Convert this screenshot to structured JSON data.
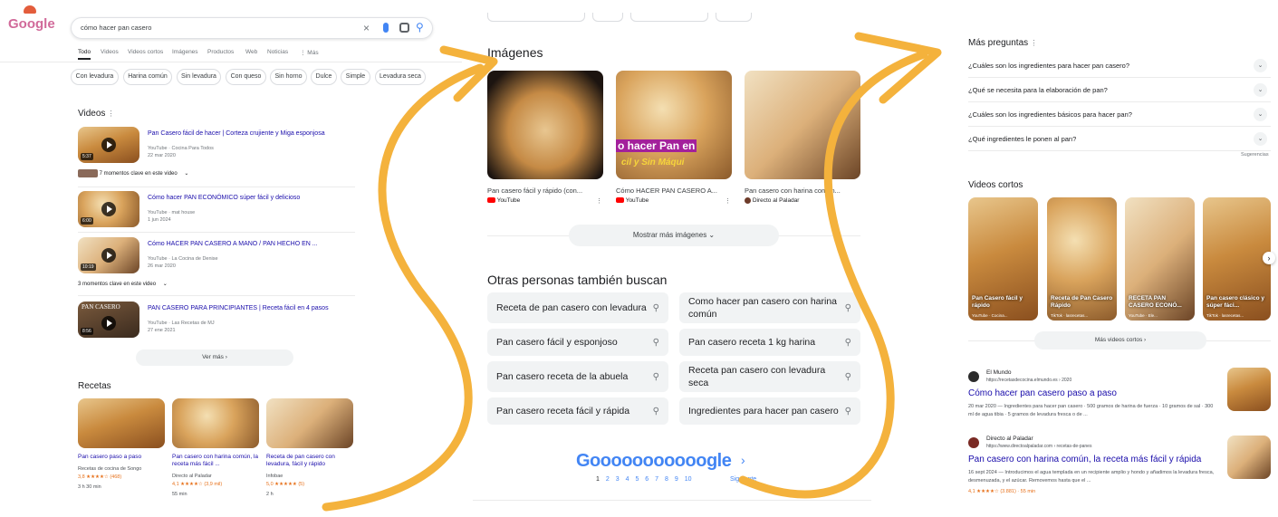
{
  "search": {
    "logo": "Google",
    "query": "cómo hacer pan casero",
    "tabs": [
      "Todo",
      "Videos",
      "Videos cortos",
      "Imágenes",
      "Productos",
      "Web",
      "Noticias",
      "⋮ Más"
    ],
    "chips": [
      "Con levadura",
      "Harina común",
      "Sin levadura",
      "Con queso",
      "Sin horno",
      "Dulce",
      "Simple",
      "Levadura seca"
    ]
  },
  "videos": {
    "heading": "Videos",
    "items": [
      {
        "title": "Pan Casero fácil de hacer | Corteza crujiente y Miga esponjosa",
        "source": "YouTube · Cocina Para Todos",
        "date": "22 mar 2020",
        "duration": "5:37"
      },
      {
        "title": "Cómo hacer PAN ECONÓMICO súper fácil y delicioso",
        "source": "YouTube · mat house",
        "date": "1 jun 2024",
        "duration": "6:00"
      },
      {
        "title": "Cómo HACER PAN CASERO A MANO / PAN HECHO EN ...",
        "source": "YouTube · La Cocina de Denise",
        "date": "26 mar 2020",
        "duration": "10:19"
      },
      {
        "title": "PAN CASERO PARA PRINCIPIANTES | Receta fácil en 4 pasos",
        "source": "YouTube · Las Recetas de MJ",
        "date": "27 ene 2021",
        "duration": "8:56",
        "thumb_text": "PAN CASERO"
      }
    ],
    "moments_1": "7 momentos clave en este video",
    "moments_3": "3 momentos clave en este video",
    "more": "Ver más"
  },
  "recipes": {
    "heading": "Recetas",
    "items": [
      {
        "title": "Pan casero paso a paso",
        "source": "Recetas de cocina de Songo",
        "rating": "3,8 ★★★★☆ (468)",
        "time": "3 h 30 min"
      },
      {
        "title": "Pan casero con harina común, la receta más fácil ...",
        "source": "Directo al Paladar",
        "rating": "4,1 ★★★★☆ (3,9 mil)",
        "time": "55 min"
      },
      {
        "title": "Receta de pan casero con levadura, fácil y rápido",
        "source": "Infobae",
        "rating": "5,0 ★★★★★ (5)",
        "time": "2 h"
      }
    ]
  },
  "images": {
    "heading": "Imágenes",
    "items": [
      {
        "caption": "Pan casero fácil y rápido (con...",
        "source": "YouTube"
      },
      {
        "caption": "Cómo HACER PAN CASERO A...",
        "source": "YouTube",
        "overlay": "o hacer Pan en",
        "overlay2": "cil y Sin Máqui"
      },
      {
        "caption": "Pan casero con harina común...",
        "source": "Directo al Paladar"
      }
    ],
    "more": "Mostrar más imágenes"
  },
  "related": {
    "heading": "Otras personas también buscan",
    "items": [
      "Receta de pan casero con levadura",
      "Como hacer pan casero con harina común",
      "Pan casero fácil y esponjoso",
      "Pan casero receta 1 kg harina",
      "Pan casero receta de la abuela",
      "Receta pan casero con levadura seca",
      "Pan casero receta fácil y rápida",
      "Ingredientes para hacer pan casero"
    ]
  },
  "pagination": {
    "logo": "Gooooooooooogle",
    "pages": [
      "1",
      "2",
      "3",
      "4",
      "5",
      "6",
      "7",
      "8",
      "9",
      "10"
    ],
    "next": "Siguiente"
  },
  "paa": {
    "heading": "Más preguntas",
    "questions": [
      "¿Cuáles son los ingredientes para hacer pan casero?",
      "¿Qué se necesita para la elaboración de pan?",
      "¿Cuáles son los ingredientes básicos para hacer pan?",
      "¿Qué ingredientes le ponen al pan?"
    ],
    "feedback": "Sugerencias"
  },
  "shorts": {
    "heading": "Videos cortos",
    "items": [
      {
        "caption": "Pan Casero fácil y rápido",
        "source": "YouTube · Cocina..."
      },
      {
        "caption": "Receta de Pan Casero Rápido",
        "source": "TikTok · lasrecetas..."
      },
      {
        "caption": "RECETA PAN CASERO ECONÓ...",
        "source": "YouTube · Ele..."
      },
      {
        "caption": "Pan casero clásico y súper fáci...",
        "source": "TikTok · lasrecetas..."
      }
    ],
    "more": "Más videos cortos"
  },
  "results": [
    {
      "site": "El Mundo",
      "url": "https://recetasdecocina.elmundo.es › 2020",
      "title": "Cómo hacer pan casero paso a paso",
      "snippet": "20 mar 2020 — Ingredientes para hacer pan casero · 500 gramos de harina de fuerza · 10 gramos de sal · 300 ml de agua tibia · 5 gramos de levadura fresca o de ..."
    },
    {
      "site": "Directo al Paladar",
      "url": "https://www.directoalpaladar.com › recetas-de-panes",
      "title": "Pan casero con harina común, la receta más fácil y rápida",
      "snippet": "16 sept 2024 — Introducimos el agua templada en un recipiente amplio y hondo y añadimos la levadura fresca, desmenuzada, y el azúcar. Removemos hasta que el ...",
      "rating": "4,1 ★★★★☆ (3.881) · 55 min"
    }
  ],
  "colors": {
    "link": "#1a0dab",
    "arrow": "#f4b23c",
    "chip_border": "#dadce0",
    "related_bg": "#f1f3f4"
  }
}
